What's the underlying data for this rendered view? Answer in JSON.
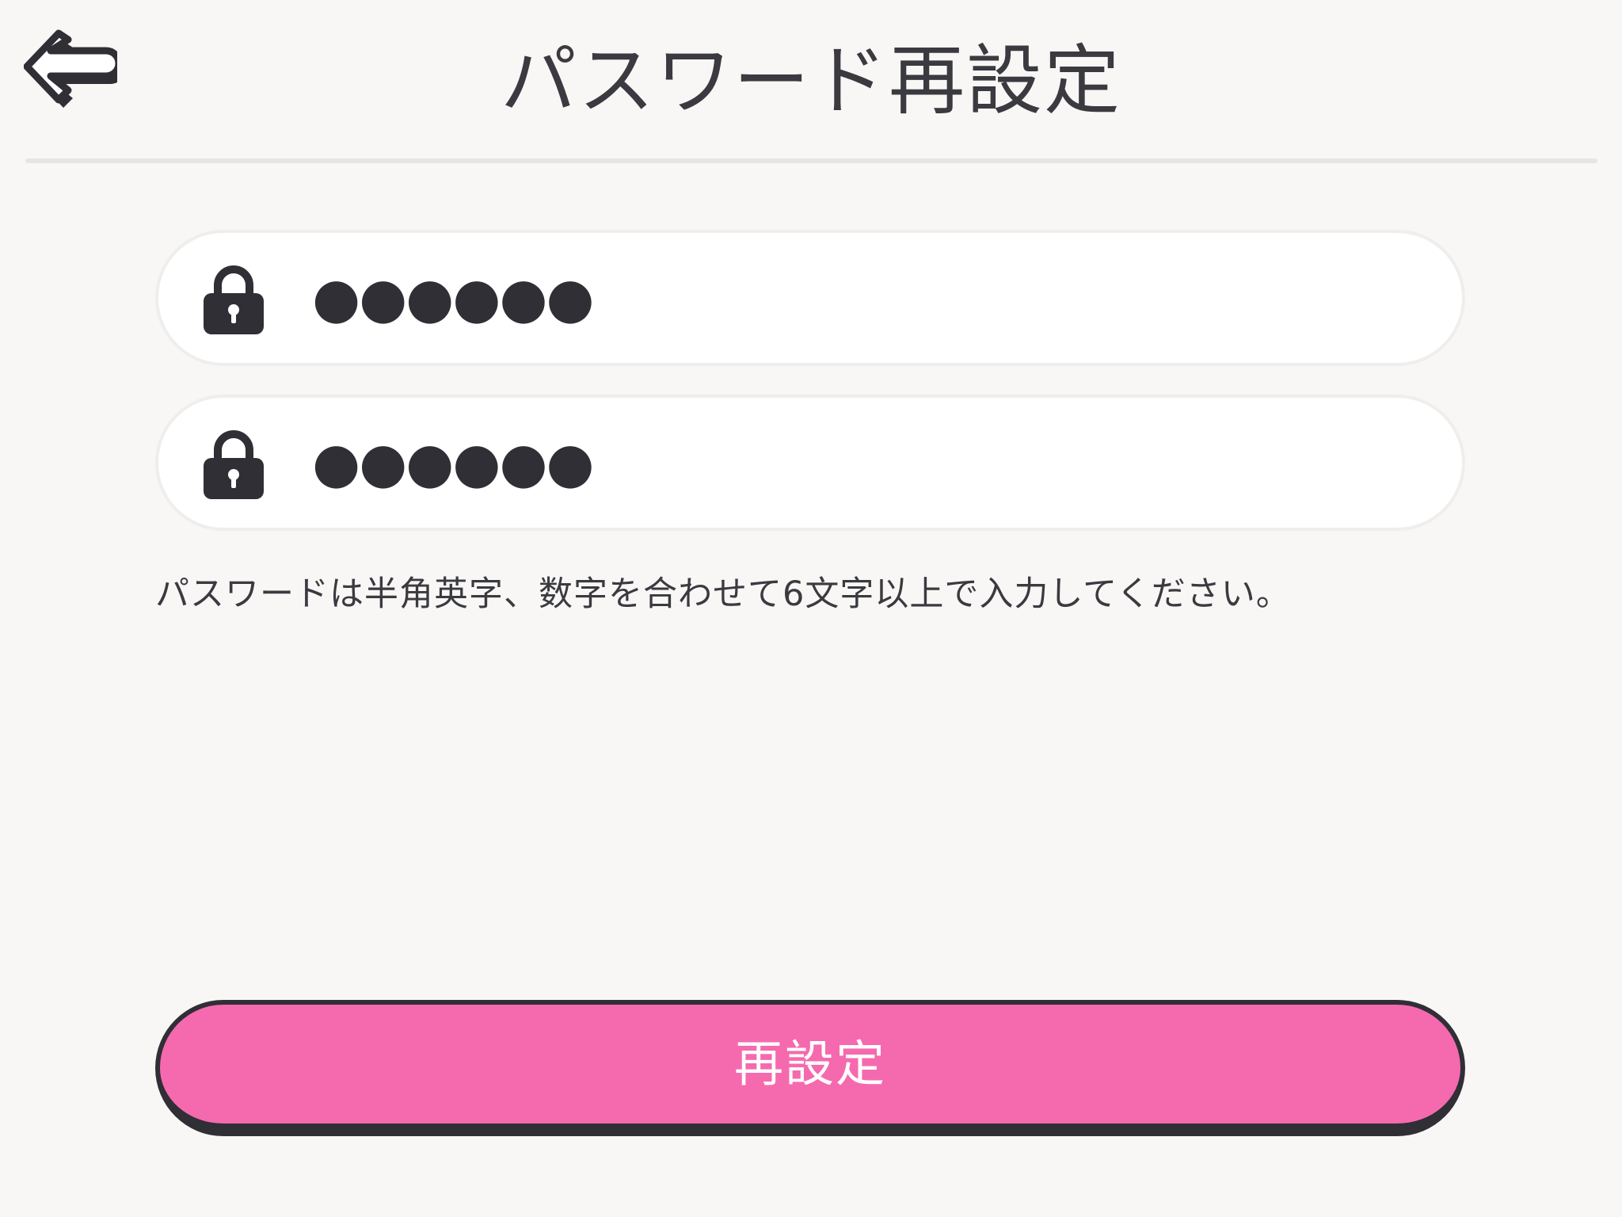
{
  "header": {
    "title": "パスワード再設定",
    "back_icon": "back-arrow-icon"
  },
  "form": {
    "password_field": {
      "icon": "lock-icon",
      "value": "●●●●●●"
    },
    "confirm_password_field": {
      "icon": "lock-icon",
      "value": "●●●●●●"
    },
    "hint": "パスワードは半角英字、数字を合わせて6文字以上で入力してください。"
  },
  "submit": {
    "label": "再設定"
  },
  "colors": {
    "background": "#f8f7f5",
    "accent": "#f56aae",
    "text": "#3a3a40",
    "outline": "#2f2f35"
  }
}
